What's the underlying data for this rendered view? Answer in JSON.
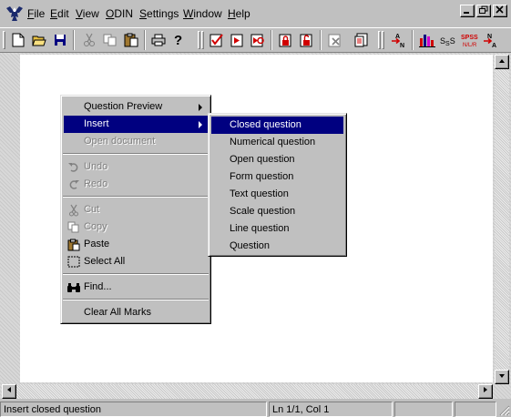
{
  "menubar": {
    "items": [
      {
        "label": "File",
        "u": "F",
        "rest": "ile"
      },
      {
        "label": "Edit",
        "u": "E",
        "rest": "dit"
      },
      {
        "label": "View",
        "u": "V",
        "rest": "iew"
      },
      {
        "label": "ODIN",
        "u": "O",
        "rest": "DIN"
      },
      {
        "label": "Settings",
        "u": "S",
        "rest": "ettings"
      },
      {
        "label": "Window",
        "u": "W",
        "rest": "indow"
      },
      {
        "label": "Help",
        "u": "H",
        "rest": "elp"
      }
    ],
    "window_buttons": [
      "_",
      "◿",
      "x"
    ]
  },
  "toolbar": {
    "spss_label": "SPSS",
    "sss_label": "SsS",
    "na_label": "N A",
    "an_label": "A N"
  },
  "context_menu": {
    "items": [
      {
        "label": "Question Preview",
        "state": "normal",
        "submenu": true
      },
      {
        "label": "Insert",
        "state": "selected",
        "submenu": true
      },
      {
        "label": "Open document",
        "state": "disabled"
      },
      {
        "label": "Undo",
        "state": "disabled",
        "icon": "undo-icon"
      },
      {
        "label": "Redo",
        "state": "disabled",
        "icon": "redo-icon"
      },
      {
        "label": "Cut",
        "state": "disabled",
        "icon": "scissors-icon"
      },
      {
        "label": "Copy",
        "state": "disabled",
        "icon": "copy-icon"
      },
      {
        "label": "Paste",
        "state": "normal",
        "icon": "clipboard-icon"
      },
      {
        "label": "Select All",
        "state": "normal",
        "icon": "select-all-icon"
      },
      {
        "label": "Find...",
        "state": "normal",
        "icon": "binoculars-icon"
      },
      {
        "label": "Clear All Marks",
        "state": "normal"
      }
    ]
  },
  "submenu": {
    "items": [
      {
        "label": "Closed question",
        "state": "selected"
      },
      {
        "label": "Numerical question",
        "state": "normal"
      },
      {
        "label": "Open question",
        "state": "normal"
      },
      {
        "label": "Form question",
        "state": "normal"
      },
      {
        "label": "Text question",
        "state": "normal"
      },
      {
        "label": "Scale question",
        "state": "normal"
      },
      {
        "label": "Line question",
        "state": "normal"
      },
      {
        "label": "Question",
        "state": "normal"
      }
    ]
  },
  "statusbar": {
    "message": "Insert closed question",
    "position": "Ln 1/1, Col 1"
  },
  "colors": {
    "highlight": "#000080",
    "face": "#c0c0c0",
    "disabled_text": "#808080"
  }
}
